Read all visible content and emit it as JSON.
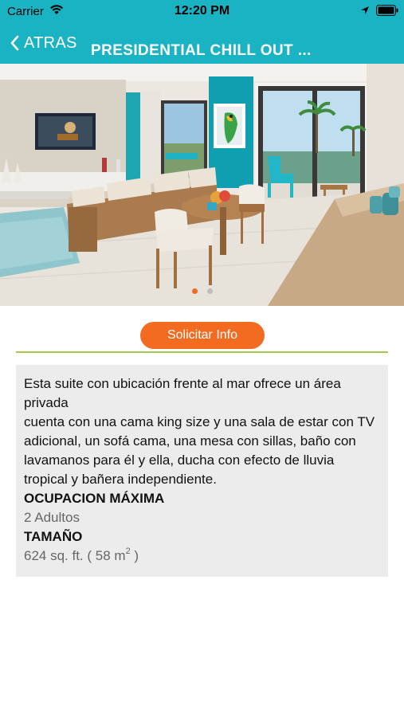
{
  "status_bar": {
    "carrier": "Carrier",
    "time": "12:20 PM"
  },
  "nav": {
    "back_label": "ATRAS",
    "title": "PRESIDENTIAL CHILL OUT ..."
  },
  "hero": {
    "icon": "photo-carousel",
    "page_count": 2,
    "active_page": 1
  },
  "actions": {
    "request_info_label": "Solicitar Info"
  },
  "description": {
    "line1": "Esta suite con ubicación frente al mar ofrece un área privada",
    "line2": "cuenta con una cama king size y una sala de estar con TV adicional, un sofá cama, una mesa con sillas, baño con lavamanos para él y ella, ducha con efecto de lluvia tropical y bañera independiente.",
    "occupancy_label": "OCUPACION MÁXIMA",
    "occupancy_value": "2 Adultos",
    "size_label": "TAMAÑO",
    "size_value_prefix": "624 sq. ft. ( 58 m",
    "size_value_sup": "2",
    "size_value_suffix": " )"
  },
  "colors": {
    "header": "#1ab3c4",
    "accent_button": "#f26b21",
    "divider": "#a3c94a",
    "card_bg": "#ececec"
  }
}
